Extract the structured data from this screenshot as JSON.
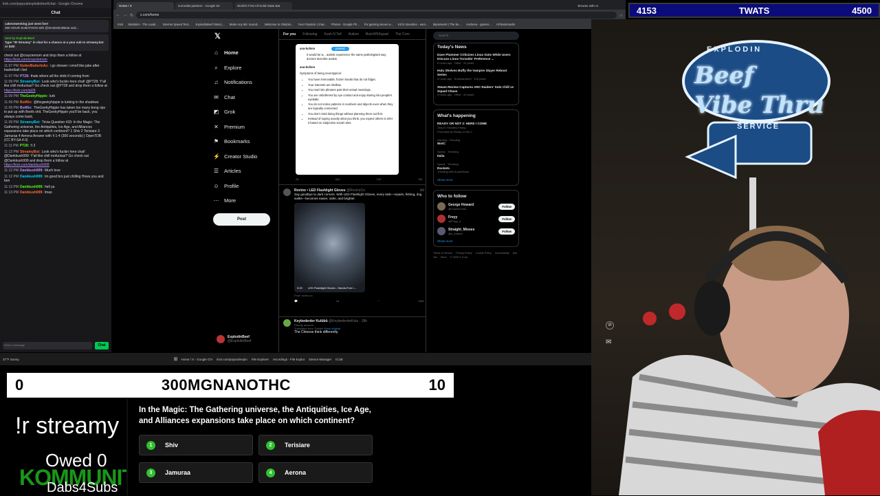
{
  "chat": {
    "titlebar": "kick.com/popout/explodinbeef/chat - Google Chrome",
    "header": "Chat",
    "pinned_title": "cakeonwesting just went live!",
    "pinned_text": "360 HOUR SUBATHON with @SmokeDuhBear and...",
    "sent_by": "Sent by ExplodinBeef",
    "sent_text": "Type \"!R Streamy\" in chat for a chance at a year sub to streamy.bot or $25!",
    "messages": [
      {
        "ts": "",
        "name": "",
        "text": "check out @crazziemom and drop them a follow at",
        "link": "https://kick.com/crazziemom"
      },
      {
        "ts": "11:07 PM",
        "name": "NutterButterInAz:",
        "text": "i go shower i smell like jake after basketball i bet",
        "link": ""
      },
      {
        "ts": "11:07 PM",
        "name": "PT28:",
        "text": "thats where all the stink if coming from",
        "link": ""
      },
      {
        "ts": "11:09 PM",
        "name": "StreamyBot:",
        "text": "Look who's fuckin here chat! @PT28: Y'all like chill mofuckas? Go check out @PT28 and drop them a follow at",
        "link": "https://kick.com/pt28"
      },
      {
        "ts": "11:09 PM",
        "name": "TheGeekyHippie:",
        "text": "lurk",
        "link": ""
      },
      {
        "ts": "11:09 PM",
        "name": "BotRix:",
        "text": "@thegeekyhippie is lurking in the shadows",
        "link": ""
      },
      {
        "ts": "11:09 PM",
        "name": "BotRix:",
        "text": "TheGeekyHippie has taken too many bong rips to put up with Beefs shit. TheGeekyHippie you'll be back, you always come back.",
        "link": ""
      },
      {
        "ts": "11:09 PM",
        "name": "StreamyBot:",
        "text": "Trivia Question #33: In the Magic: The Gathering universe, the Antiquities, Ice Age, and Alliances expansions take place on which continent? 1 Shiv 2 Terisiare 3 Jamuraa 4 Aerona Answer with !t 1-4 (300 seconds) | OpenTDB (CC BY-SA 4.0)",
        "link": ""
      },
      {
        "ts": "11:11 PM",
        "name": "PT28:",
        "text": "!t 3",
        "link": ""
      },
      {
        "ts": "11:12 PM",
        "name": "StreamyBot:",
        "text": "Look who's fuckin here chat! @Dankkush999: Y'all like chill mofuckas? Go check out @Dankkush999 and drop them a follow at",
        "link": "https://kick.com/dankkush999"
      },
      {
        "ts": "11:12 PM",
        "name": "Dankkush999:",
        "text": "Much love",
        "link": ""
      },
      {
        "ts": "11:12 PM",
        "name": "Dankkush999:",
        "text": "Im good bro just chilling Hows you and fam",
        "link": ""
      },
      {
        "ts": "11:13 PM",
        "name": "Dankkush999:",
        "text": "hell ya",
        "link": ""
      },
      {
        "ts": "11:13 PM",
        "name": "Dankkush999:",
        "text": "lmao",
        "link": ""
      }
    ],
    "input_placeholder": "Send a message",
    "send_label": "Chat"
  },
  "browser": {
    "tabs": [
      "Home / X",
      "surrealist painters - Google Se",
      "World's First All-Solid-State Bat"
    ],
    "address": "x.com/home",
    "browse_ai": "Browse with AI",
    "bookmarks": [
      "Kick",
      "Statistics - The Loadi...",
      "Internet Speed Test...",
      "ExplodinBeef Stats |...",
      "Make Any Mic Sound...",
      "Welcome to Okidoki...",
      "Your Popsicle | chat...",
      "Photos - Google Ph...",
      "Fix gaming issues w...",
      "KICK Bounties - earn...",
      "Mynetwork | The be...",
      "Andorea - gamen...",
      "All Bookmarks"
    ]
  },
  "x": {
    "nav": [
      {
        "label": "Home",
        "icon": "home-icon",
        "glyph": "⌂"
      },
      {
        "label": "Explore",
        "icon": "search-icon",
        "glyph": "⌕"
      },
      {
        "label": "Notifications",
        "icon": "bell-icon",
        "glyph": "♫"
      },
      {
        "label": "Chat",
        "icon": "chat-icon",
        "glyph": "✉"
      },
      {
        "label": "Grok",
        "icon": "grok-icon",
        "glyph": "◩"
      },
      {
        "label": "Premium",
        "icon": "premium-icon",
        "glyph": "✕"
      },
      {
        "label": "Bookmarks",
        "icon": "bookmark-icon",
        "glyph": "⚑"
      },
      {
        "label": "Creator Studio",
        "icon": "creator-icon",
        "glyph": "⚡"
      },
      {
        "label": "Articles",
        "icon": "articles-icon",
        "glyph": "☰"
      },
      {
        "label": "Profile",
        "icon": "profile-icon",
        "glyph": "☺"
      },
      {
        "label": "More",
        "icon": "more-icon",
        "glyph": "⋯"
      }
    ],
    "post_label": "Post",
    "profile_name": "ExplodinBeef",
    "profile_handle": "@ExplodinBeef",
    "feed_tabs": [
      "For you",
      "Following",
      "Kush N Tell",
      "Autism",
      "ButchPitSquad",
      "The Com"
    ],
    "posted_badge": "posted",
    "tweet1_card": {
      "user": "ana-bolism",
      "intro": "It would be w... autistic experience the same pathologised way doctors describe autism",
      "user2": "ana-bolism",
      "heading": "Symptoms of being neurotypical:",
      "bullets": [
        "You have immovable, frozen hands that do not fidget.",
        "Your interests are shallow.",
        "You read into phrases past their actual meanings.",
        "You are unbothered by eye contact and enjoy staring into people's eyeballs.",
        "You do not notice patterns in numbers and objects even when they are logically connected.",
        "You don't mind doing things without planning them out first.",
        "Instead of saying exactly what you think, you expect others to infer it based on subjective social rules."
      ],
      "stats": [
        "28",
        "",
        "844",
        "12K",
        "78K"
      ]
    },
    "tweet2": {
      "name": "Rovino • LED Flashlight Gloves",
      "handle": "@RovinoCo",
      "ad": "Ad",
      "text": "Say goodbye to dark corners. With LED Flashlight Gloves, every task—repairs, fishing, dog walks—becomes easier, safer, and brighter.",
      "video_time": "0:20",
      "video_caption": "LED Flashlight Gloves - Hands-Free L...",
      "from": "From rovino.co",
      "stats": [
        "",
        "18",
        "",
        "116K"
      ]
    },
    "tweet3": {
      "name": "Keybedenler Kulübü",
      "handle": "@KeybedenlerKulu · 18h",
      "parody": "Parody account",
      "translated": "Translated from Turkish",
      "show_original": "Show original",
      "text": "The Chinese think differently."
    },
    "search_placeholder": "Search",
    "todays_news": "Today's News",
    "news": [
      {
        "title": "Dave Plummer Criticizes Linux GUIs While Users Discuss Linus Torvalds' Preference ...",
        "meta": "5 hours ago · Other · 91 posts"
      },
      {
        "title": "Hulu Shelves Buffy the Vampire Slayer Reboot Series",
        "meta": "5 hours ago · Entertainment · 128 posts"
      },
      {
        "title": "Steam Review Captures ARC Raiders' Solo Chill vs Squad Chaos",
        "meta": "5 hours ago · Other · 64 posts"
      }
    ],
    "whats_happening": "What's happening",
    "trends": [
      {
        "cat": "",
        "name": "READY OR NOT 2: HERE I COME",
        "meta": "Only in Theaters Friday",
        "promo": "Promoted by Ready or Not 2"
      },
      {
        "cat": "Gaming · Trending",
        "name": "WotC",
        "meta": "",
        "promo": ""
      },
      {
        "cat": "Sports · Trending",
        "name": "Italia",
        "meta": "",
        "promo": ""
      },
      {
        "cat": "Sports · Trending",
        "name": "Rockets",
        "meta": "Trending with #LakeShow",
        "promo": ""
      }
    ],
    "show_more": "Show more",
    "who_to_follow": "Who to follow",
    "follow_suggestions": [
      {
        "name": "George Howard",
        "handle": "@CosmicTusk"
      },
      {
        "name": "Freyy",
        "handle": "@Freyy_s"
      },
      {
        "name": "Straight_Misses",
        "handle": "@s_misses"
      }
    ],
    "follow_label": "Follow",
    "footer": [
      "Terms of Service",
      "Privacy Policy",
      "Cookie Policy",
      "Accessibility",
      "Ads info",
      "More",
      "© 2025 X Corp."
    ]
  },
  "taskbar": {
    "weather": "37°F",
    "weather_sub": "Sunny",
    "apps": [
      "Home / X - Google Chr",
      "kick.com/popout/explo",
      "File Explorer",
      "recordings - File Explor",
      "Device Manager",
      "ICUE"
    ]
  },
  "score_top": {
    "left": "4153",
    "center": "TWATS",
    "right": "4500"
  },
  "score_bottom": {
    "left": "0",
    "center": "300MGNANOTHC",
    "right": "10"
  },
  "trivia": {
    "question": "In the Magic: The Gathering universe, the Antiquities, Ice Age, and Alliances expansions take place on which continent?",
    "options": [
      {
        "num": "1",
        "label": "Shiv"
      },
      {
        "num": "2",
        "label": "Terisiare"
      },
      {
        "num": "3",
        "label": "Jamuraa"
      },
      {
        "num": "4",
        "label": "Aerona"
      }
    ]
  },
  "overlay": {
    "streamy": "!r streamy",
    "owed": "Owed 0",
    "community": "KOMMUNITY",
    "dabs": "Dabs4Subs"
  },
  "sign": {
    "top": "EXPLODIN",
    "line1": "Beef",
    "line2": "Vibe Thru",
    "service": "SERVICE"
  }
}
